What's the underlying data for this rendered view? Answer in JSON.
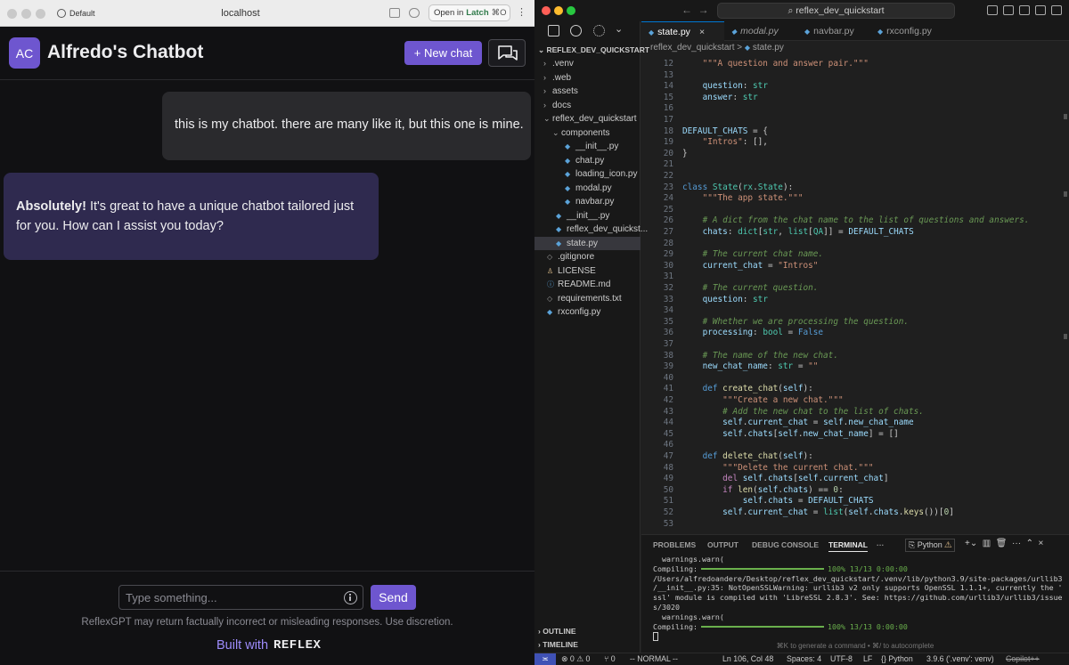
{
  "browser": {
    "profile": "Default",
    "url": "localhost",
    "open_in": {
      "prefix": "Open in",
      "app": "Latch",
      "shortcut": "⌘O"
    }
  },
  "chat": {
    "avatar": "AC",
    "title": "Alfredo's Chatbot",
    "new_chat_label": "+ New chat",
    "messages": {
      "user": "this is my chatbot. there are many like it, but this one is mine.",
      "bot_bold": "Absolutely!",
      "bot_rest": " It's great to have a unique chatbot tailored just for you. How can I assist you today?"
    },
    "input_placeholder": "Type something...",
    "send_label": "Send",
    "disclaimer": "ReflexGPT may return factually incorrect or misleading responses. Use discretion.",
    "built_with": "Built with",
    "brand": "REFLEX"
  },
  "vscode": {
    "search": "reflex_dev_quickstart",
    "explorer": {
      "root": "REFLEX_DEV_QUICKSTART",
      "items": [
        {
          "label": ".venv",
          "kind": "folder",
          "depth": 0,
          "open": false
        },
        {
          "label": ".web",
          "kind": "folder",
          "depth": 0,
          "open": false
        },
        {
          "label": "assets",
          "kind": "folder",
          "depth": 0,
          "open": false
        },
        {
          "label": "docs",
          "kind": "folder",
          "depth": 0,
          "open": false
        },
        {
          "label": "reflex_dev_quickstart",
          "kind": "folder",
          "depth": 0,
          "open": true
        },
        {
          "label": "components",
          "kind": "folder",
          "depth": 1,
          "open": true
        },
        {
          "label": "__init__.py",
          "kind": "py",
          "depth": 2
        },
        {
          "label": "chat.py",
          "kind": "py",
          "depth": 2
        },
        {
          "label": "loading_icon.py",
          "kind": "py",
          "depth": 2
        },
        {
          "label": "modal.py",
          "kind": "py",
          "depth": 2
        },
        {
          "label": "navbar.py",
          "kind": "py",
          "depth": 2
        },
        {
          "label": "__init__.py",
          "kind": "py",
          "depth": 1
        },
        {
          "label": "reflex_dev_quickst...",
          "kind": "py",
          "depth": 1
        },
        {
          "label": "state.py",
          "kind": "py",
          "depth": 1,
          "selected": true
        },
        {
          "label": ".gitignore",
          "kind": "file",
          "depth": 0
        },
        {
          "label": "LICENSE",
          "kind": "license",
          "depth": 0
        },
        {
          "label": "README.md",
          "kind": "info",
          "depth": 0
        },
        {
          "label": "requirements.txt",
          "kind": "file",
          "depth": 0
        },
        {
          "label": "rxconfig.py",
          "kind": "py",
          "depth": 0
        }
      ],
      "outline": "OUTLINE",
      "timeline": "TIMELINE"
    },
    "tabs": [
      "state.py",
      "modal.py",
      "navbar.py",
      "rxconfig.py"
    ],
    "breadcrumb": [
      "reflex_dev_quickstart",
      "state.py"
    ],
    "code": [
      {
        "n": 12,
        "h": "    <span class=\"s\">\"\"\"A question and answer pair.\"\"\"</span>"
      },
      {
        "n": 13,
        "h": ""
      },
      {
        "n": 14,
        "h": "    <span class=\"v\">question</span>: <span class=\"t\">str</span>"
      },
      {
        "n": 15,
        "h": "    <span class=\"v\">answer</span>: <span class=\"t\">str</span>"
      },
      {
        "n": 16,
        "h": ""
      },
      {
        "n": 17,
        "h": ""
      },
      {
        "n": 18,
        "h": "<span class=\"v\">DEFAULT_CHATS</span> = {"
      },
      {
        "n": 19,
        "h": "    <span class=\"s\">\"Intros\"</span>: [],"
      },
      {
        "n": 20,
        "h": "}"
      },
      {
        "n": 21,
        "h": ""
      },
      {
        "n": 22,
        "h": ""
      },
      {
        "n": 23,
        "h": "<span class=\"k\">class</span> <span class=\"t\">State</span>(<span class=\"t\">rx</span>.<span class=\"t\">State</span>):"
      },
      {
        "n": 24,
        "h": "    <span class=\"s\">\"\"\"The app state.\"\"\"</span>"
      },
      {
        "n": 25,
        "h": ""
      },
      {
        "n": 26,
        "h": "    <span class=\"cm\"># A dict from the chat name to the list of questions and answers.</span>"
      },
      {
        "n": 27,
        "h": "    <span class=\"v\">chats</span>: <span class=\"t\">dict</span>[<span class=\"t\">str</span>, <span class=\"t\">list</span>[<span class=\"t\">QA</span>]] = <span class=\"v\">DEFAULT_CHATS</span>"
      },
      {
        "n": 28,
        "h": ""
      },
      {
        "n": 29,
        "h": "    <span class=\"cm\"># The current chat name.</span>"
      },
      {
        "n": 30,
        "h": "    <span class=\"v\">current_chat</span> = <span class=\"s\">\"Intros\"</span>"
      },
      {
        "n": 31,
        "h": ""
      },
      {
        "n": 32,
        "h": "    <span class=\"cm\"># The current question.</span>"
      },
      {
        "n": 33,
        "h": "    <span class=\"v\">question</span>: <span class=\"t\">str</span>"
      },
      {
        "n": 34,
        "h": ""
      },
      {
        "n": 35,
        "h": "    <span class=\"cm\"># Whether we are processing the question.</span>"
      },
      {
        "n": 36,
        "h": "    <span class=\"v\">processing</span>: <span class=\"t\">bool</span> = <span class=\"k\">False</span>"
      },
      {
        "n": 37,
        "h": ""
      },
      {
        "n": 38,
        "h": "    <span class=\"cm\"># The name of the new chat.</span>"
      },
      {
        "n": 39,
        "h": "    <span class=\"v\">new_chat_name</span>: <span class=\"t\">str</span> = <span class=\"s\">\"\"</span>"
      },
      {
        "n": 40,
        "h": ""
      },
      {
        "n": 41,
        "h": "    <span class=\"k\">def</span> <span class=\"f\">create_chat</span>(<span class=\"v\">self</span>):"
      },
      {
        "n": 42,
        "h": "        <span class=\"s\">\"\"\"Create a new chat.\"\"\"</span>"
      },
      {
        "n": 43,
        "h": "        <span class=\"cm\"># Add the new chat to the list of chats.</span>"
      },
      {
        "n": 44,
        "h": "        <span class=\"v\">self</span>.<span class=\"v\">current_chat</span> = <span class=\"v\">self</span>.<span class=\"v\">new_chat_name</span>"
      },
      {
        "n": 45,
        "h": "        <span class=\"v\">self</span>.<span class=\"v\">chats</span>[<span class=\"v\">self</span>.<span class=\"v\">new_chat_name</span>] = []"
      },
      {
        "n": 46,
        "h": ""
      },
      {
        "n": 47,
        "h": "    <span class=\"k\">def</span> <span class=\"f\">delete_chat</span>(<span class=\"v\">self</span>):"
      },
      {
        "n": 48,
        "h": "        <span class=\"s\">\"\"\"Delete the current chat.\"\"\"</span>"
      },
      {
        "n": 49,
        "h": "        <span class=\"c\">del</span> <span class=\"v\">self</span>.<span class=\"v\">chats</span>[<span class=\"v\">self</span>.<span class=\"v\">current_chat</span>]"
      },
      {
        "n": 50,
        "h": "        <span class=\"c\">if</span> <span class=\"f\">len</span>(<span class=\"v\">self</span>.<span class=\"v\">chats</span>) == <span class=\"n\">0</span>:"
      },
      {
        "n": 51,
        "h": "            <span class=\"v\">self</span>.<span class=\"v\">chats</span> = <span class=\"v\">DEFAULT_CHATS</span>"
      },
      {
        "n": 52,
        "h": "        <span class=\"v\">self</span>.<span class=\"v\">current_chat</span> = <span class=\"t\">list</span>(<span class=\"v\">self</span>.<span class=\"v\">chats</span>.<span class=\"f\">keys</span>())[<span class=\"n\">0</span>]"
      },
      {
        "n": 53,
        "h": ""
      }
    ],
    "panel": {
      "tabs": [
        "PROBLEMS",
        "OUTPUT",
        "DEBUG CONSOLE",
        "TERMINAL",
        "···"
      ],
      "active_tab": "TERMINAL",
      "shell": "Python",
      "terminal": {
        "line1": "  warnings.warn(",
        "compiling": "Compiling:",
        "progress": "100% 13/13 0:00:00",
        "path1": "/Users/alfredoandere/Desktop/reflex_dev_quickstart/.venv/lib/python3.9/site-packages/urllib3",
        "path2": "/__init__.py:35: NotOpenSSLWarning: urllib3 v2 only supports OpenSSL 1.1.1+, currently the '",
        "path3": "ssl' module is compiled with 'LibreSSL 2.8.3'. See: https://github.com/urllib3/urllib3/issue",
        "path4": "s/3020",
        "line6": "  warnings.warn(",
        "progress_fraction": 1.0
      },
      "hint": "⌘K to generate a command • ⌘/ to autocomplete"
    },
    "status": {
      "problems": "⊗ 0 ⚠ 0",
      "ports": "⑂ 0",
      "vim_mode": "-- NORMAL --",
      "position": "Ln 106, Col 48",
      "spaces": "Spaces: 4",
      "encoding": "UTF-8",
      "eol": "LF",
      "language": "{} Python",
      "interpreter": "3.9.6 ('.venv': venv)",
      "copilot": "Copilot++"
    }
  },
  "colors": {
    "accent": "#6e56cf",
    "vs_blue": "#0078d4",
    "traffic_red": "#ff5f57",
    "traffic_yellow": "#febc2e",
    "traffic_green": "#28c840"
  }
}
